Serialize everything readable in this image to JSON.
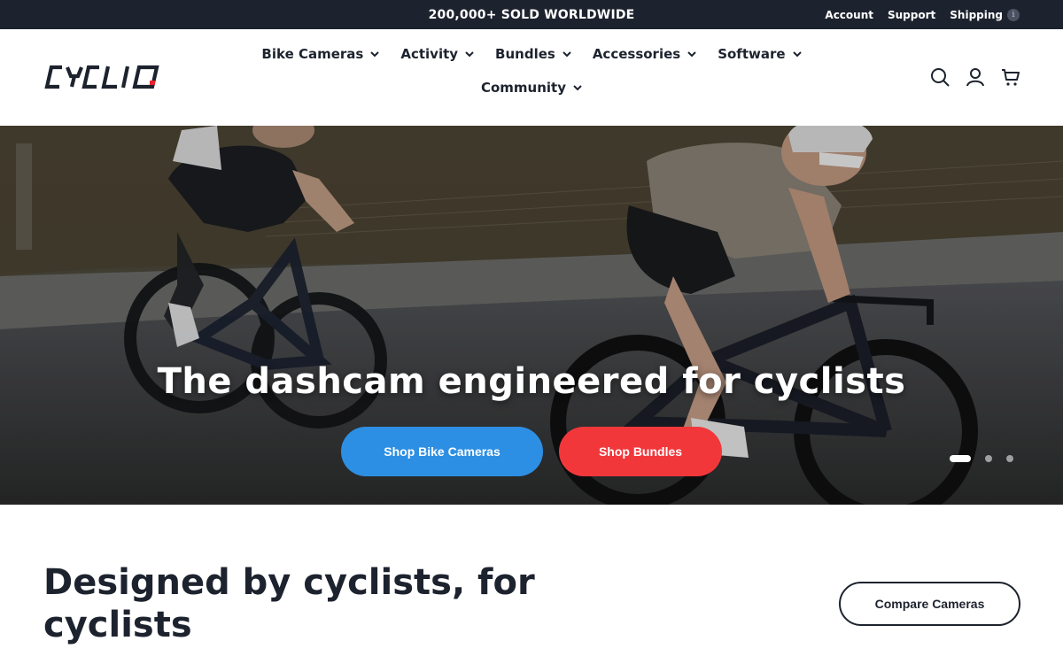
{
  "announcement": {
    "text": "200,000+ SOLD WORLDWIDE"
  },
  "utility_links": {
    "account": "Account",
    "support": "Support",
    "shipping": "Shipping",
    "info_icon": "i"
  },
  "brand": {
    "logo_text": "CYCLIQ",
    "accent": "#e8232a"
  },
  "nav": {
    "items": [
      {
        "label": "Bike Cameras"
      },
      {
        "label": "Activity"
      },
      {
        "label": "Bundles"
      },
      {
        "label": "Accessories"
      },
      {
        "label": "Software"
      },
      {
        "label": "Community"
      }
    ]
  },
  "header_icons": [
    "search-icon",
    "account-icon",
    "cart-icon"
  ],
  "hero": {
    "title": "The dashcam engineered for cyclists",
    "primary_button": "Shop Bike Cameras",
    "secondary_button": "Shop Bundles",
    "slides_total": 3,
    "active_slide": 1
  },
  "section": {
    "title": "Designed by cyclists, for cyclists",
    "compare_button": "Compare Cameras"
  },
  "colors": {
    "dark": "#1d232e",
    "blue_button": "#2d8fe3",
    "red_button": "#f2373b"
  }
}
